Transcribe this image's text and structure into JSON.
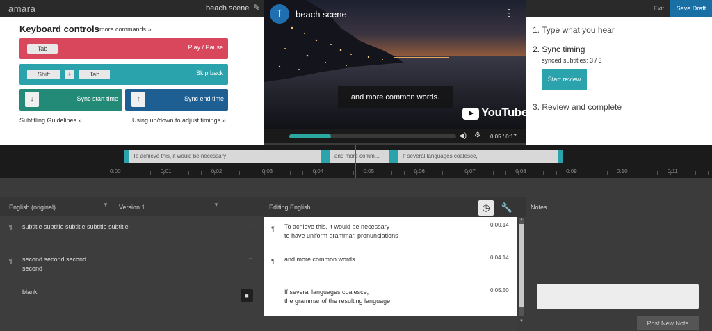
{
  "topbar": {
    "logo": "amara",
    "title": "beach scene",
    "exit": "Exit",
    "save": "Save Draft"
  },
  "keyboard": {
    "title": "Keyboard controls",
    "more": "more commands »",
    "rows": [
      {
        "keys": [
          "Tab"
        ],
        "action": "Play / Pause",
        "color": "#d9475d"
      },
      {
        "keys": [
          "Shift",
          "+",
          "Tab"
        ],
        "action": "Skip back",
        "color": "#2aa3ad"
      }
    ],
    "sync_start": {
      "icon": "arrow-down-icon",
      "label": "Sync start time",
      "color": "#248a78"
    },
    "sync_end": {
      "icon": "arrow-up-icon",
      "label": "Sync end time",
      "color": "#1e5f93"
    },
    "guidelines": "Subtitling Guidelines »",
    "updown": "Using up/down to adjust timings »"
  },
  "video": {
    "avatar": "T",
    "title": "beach scene",
    "caption": "and more common words.",
    "brand": "YouTube",
    "time": "0:05 / 0:17",
    "progress": 0.25
  },
  "steps": {
    "s1": "1. Type what you hear",
    "s2": "2. Sync timing",
    "s2_sub": "synced subtitles: 3 / 3",
    "start_review": "Start review",
    "s3": "3. Review and complete"
  },
  "timeline": {
    "subs": [
      "To achieve this, it would be necessary",
      "and more comm...",
      "If several languages coalesce,"
    ],
    "ticks": [
      "0:00",
      "0:01",
      "0:02",
      "0:03",
      "0:04",
      "0:05",
      "0:06",
      "0:07",
      "0:08",
      "0:09",
      "0:10",
      "0:11"
    ]
  },
  "reference": {
    "language": "English (original)",
    "version": "Version 1",
    "rows": [
      {
        "lines": [
          "subtitle subtitle subtitle subtitle subtitle"
        ]
      },
      {
        "lines": [
          "second second second",
          "second"
        ]
      },
      {
        "lines": [
          "blank"
        ]
      }
    ]
  },
  "editor": {
    "title": "Editing English...",
    "rows": [
      {
        "lines": [
          "To achieve this, it would be necessary",
          "to have uniform grammar, pronunciations"
        ],
        "time": "0:00.14"
      },
      {
        "lines": [
          "and more common words."
        ],
        "time": "0:04.14"
      },
      {
        "lines": [
          "If several languages coalesce,",
          "the grammar of the resulting language"
        ],
        "time": "0:05.50"
      }
    ]
  },
  "notes": {
    "title": "Notes",
    "post": "Post New Note"
  }
}
